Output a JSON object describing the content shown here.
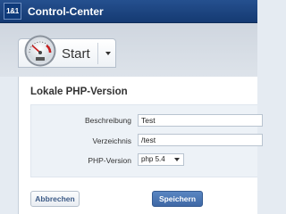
{
  "header": {
    "logo_text": "1&1",
    "app_title": "Control-Center"
  },
  "tab": {
    "label": "Start",
    "icon": "speedometer-icon",
    "menu_icon": "chevron-down-icon"
  },
  "section": {
    "title": "Lokale PHP-Version"
  },
  "form": {
    "fields": [
      {
        "label": "Beschreibung",
        "value": "Test"
      },
      {
        "label": "Verzeichnis",
        "value": "/test"
      }
    ],
    "php_version": {
      "label": "PHP-Version",
      "selected": "php 5.4"
    }
  },
  "buttons": {
    "cancel": "Abbrechen",
    "save": "Speichern"
  },
  "colors": {
    "header_bg": "#1e4a86",
    "primary_button": "#4a74b2",
    "page_bg": "#e5ebf2"
  }
}
